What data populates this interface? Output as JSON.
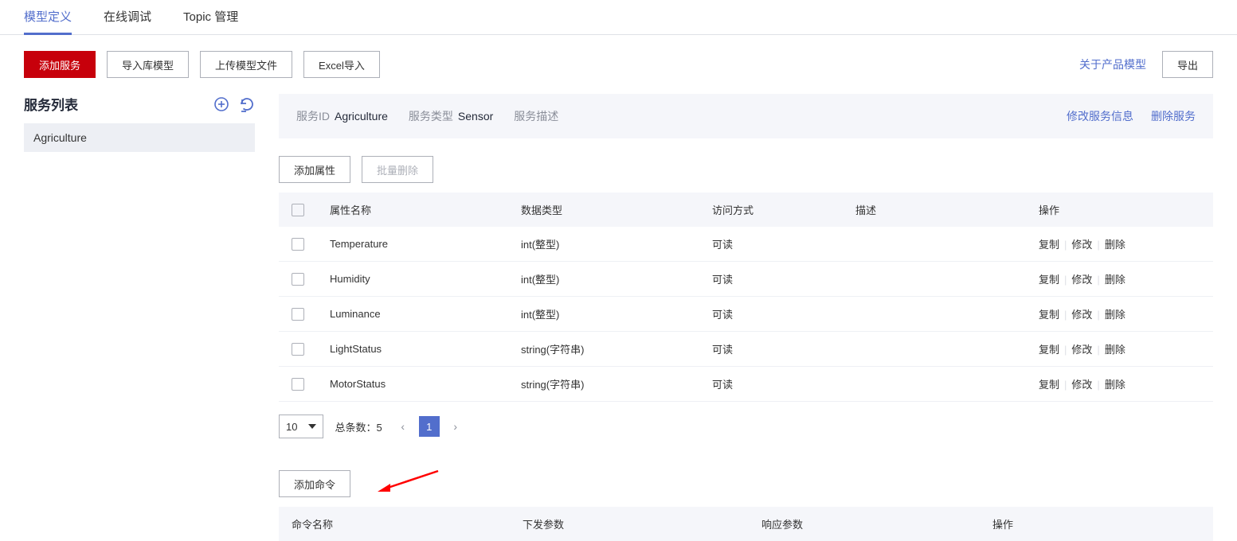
{
  "tabs": {
    "model_def": "模型定义",
    "online_debug": "在线调试",
    "topic_mgmt": "Topic 管理"
  },
  "toolbar": {
    "add_service": "添加服务",
    "import_lib": "导入库模型",
    "upload_file": "上传模型文件",
    "excel_import": "Excel导入",
    "about_link": "关于产品模型",
    "export": "导出"
  },
  "sidebar": {
    "title": "服务列表",
    "items": [
      "Agriculture"
    ]
  },
  "service": {
    "id_label": "服务ID",
    "id_value": "Agriculture",
    "type_label": "服务类型",
    "type_value": "Sensor",
    "desc_label": "服务描述",
    "desc_value": "",
    "edit": "修改服务信息",
    "delete": "删除服务"
  },
  "attr_bar": {
    "add": "添加属性",
    "batch_del": "批量删除"
  },
  "attr_table": {
    "headers": {
      "name": "属性名称",
      "type": "数据类型",
      "access": "访问方式",
      "desc": "描述",
      "ops": "操作"
    },
    "ops": {
      "copy": "复制",
      "edit": "修改",
      "delete": "删除"
    },
    "rows": [
      {
        "name": "Temperature",
        "type": "int(整型)",
        "access": "可读",
        "desc": ""
      },
      {
        "name": "Humidity",
        "type": "int(整型)",
        "access": "可读",
        "desc": ""
      },
      {
        "name": "Luminance",
        "type": "int(整型)",
        "access": "可读",
        "desc": ""
      },
      {
        "name": "LightStatus",
        "type": "string(字符串)",
        "access": "可读",
        "desc": ""
      },
      {
        "name": "MotorStatus",
        "type": "string(字符串)",
        "access": "可读",
        "desc": ""
      }
    ]
  },
  "pagination": {
    "page_size": "10",
    "total_label": "总条数：",
    "total": "5",
    "current": "1"
  },
  "cmd": {
    "add": "添加命令",
    "headers": {
      "name": "命令名称",
      "down": "下发参数",
      "resp": "响应参数",
      "ops": "操作"
    }
  }
}
